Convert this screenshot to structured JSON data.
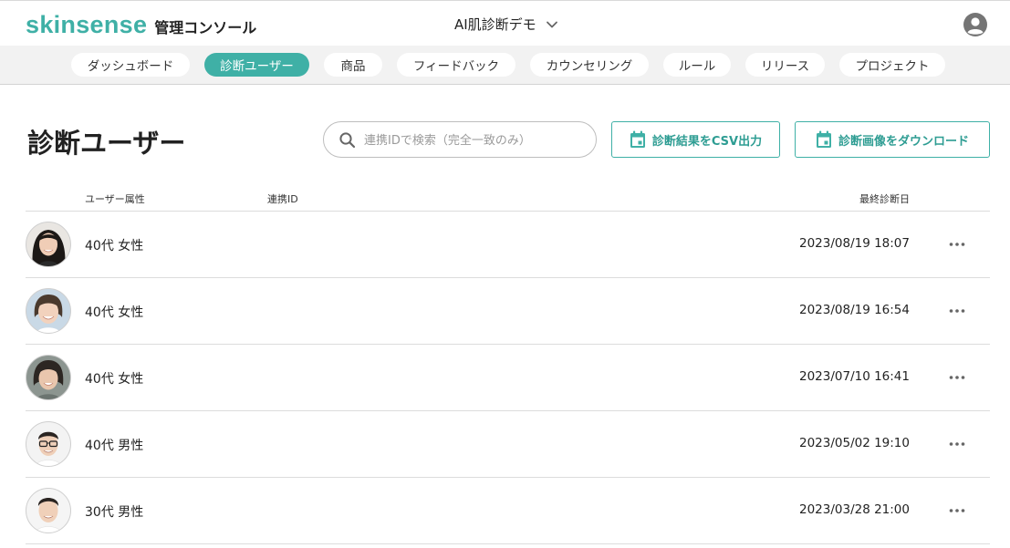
{
  "header": {
    "brand": "skinsense",
    "subtitle": "管理コンソール",
    "project": "AI肌診断デモ"
  },
  "nav": {
    "tabs": [
      {
        "label": "ダッシュボード",
        "active": false
      },
      {
        "label": "診断ユーザー",
        "active": true
      },
      {
        "label": "商品",
        "active": false
      },
      {
        "label": "フィードバック",
        "active": false
      },
      {
        "label": "カウンセリング",
        "active": false
      },
      {
        "label": "ルール",
        "active": false
      },
      {
        "label": "リリース",
        "active": false
      },
      {
        "label": "プロジェクト",
        "active": false
      }
    ]
  },
  "main": {
    "title": "診断ユーザー",
    "search_placeholder": "連携IDで検索（完全一致のみ）",
    "csv_button": "診断結果をCSV出力",
    "download_button": "診断画像をダウンロード",
    "columns": {
      "attribute": "ユーザー属性",
      "link_id": "連携ID",
      "last_date": "最終診断日"
    },
    "rows": [
      {
        "attribute": "40代 女性",
        "link_id": "",
        "date": "2023/08/19 18:07",
        "avatar": "female-long-hair-avatar"
      },
      {
        "attribute": "40代 女性",
        "link_id": "",
        "date": "2023/08/19 16:54",
        "avatar": "female-short-hair-avatar"
      },
      {
        "attribute": "40代 女性",
        "link_id": "",
        "date": "2023/07/10 16:41",
        "avatar": "female-bob-hair-avatar"
      },
      {
        "attribute": "40代 男性",
        "link_id": "",
        "date": "2023/05/02 19:10",
        "avatar": "male-glasses-avatar"
      },
      {
        "attribute": "30代 男性",
        "link_id": "",
        "date": "2023/03/28 21:00",
        "avatar": "male-short-hair-avatar"
      }
    ]
  },
  "colors": {
    "accent": "#3fb0a6",
    "nav_bg": "#f2f2f2"
  }
}
